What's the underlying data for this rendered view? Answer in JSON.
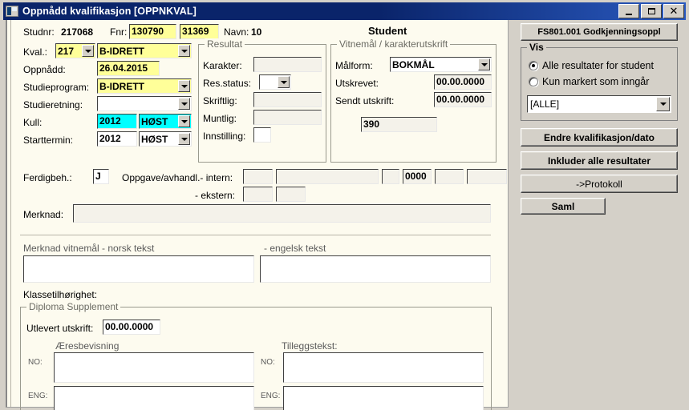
{
  "window": {
    "title": "Oppnådd kvalifikasjon [OPPNKVAL]",
    "minimize_label": "_",
    "maximize_label": "□",
    "close_label": "✕"
  },
  "header": {
    "studnr_label": "Studnr:",
    "studnr_value": "217068",
    "fnr_label": "Fnr:",
    "fnr_value1": "130790",
    "fnr_value2": "31369",
    "navn_label": "Navn:",
    "navn_value": "10",
    "student_label": "Student"
  },
  "form": {
    "kval_label": "Kval.:",
    "kval_code": "217",
    "kval_name": "B-IDRETT",
    "oppnadd_label": "Oppnådd:",
    "oppnadd_value": "26.04.2015",
    "studieprogram_label": "Studieprogram:",
    "studieprogram_value": "B-IDRETT",
    "studieretning_label": "Studieretning:",
    "studieretning_value": "",
    "kull_label": "Kull:",
    "kull_year": "2012",
    "kull_term": "HØST",
    "starttermin_label": "Starttermin:",
    "starttermin_year": "2012",
    "starttermin_term": "HØST",
    "ferdigbeh_label": "Ferdigbeh.:",
    "ferdigbeh_value": "J",
    "oppgave_intern_label": "Oppgave/avhandl.- intern:",
    "oppgave_intern_f1": "",
    "oppgave_intern_f2": "",
    "oppgave_intern_f3": "",
    "oppgave_intern_f4": "0000",
    "oppgave_intern_f5": "",
    "oppgave_intern_f6": "",
    "ekstern_label": "- ekstern:",
    "ekstern_f1": "",
    "ekstern_f2": "",
    "merknad_label": "Merknad:",
    "merknad_value": ""
  },
  "resultat": {
    "legend": "Resultat",
    "karakter_label": "Karakter:",
    "karakter_value": "",
    "resstatus_label": "Res.status:",
    "resstatus_value": "",
    "skriftlig_label": "Skriftlig:",
    "skriftlig_value": "",
    "muntlig_label": "Muntlig:",
    "muntlig_value": "",
    "innstilling_label": "Innstilling:",
    "innstilling_value": ""
  },
  "vitnemal": {
    "legend": "Vitnemål / karakterutskrift",
    "malform_label": "Målform:",
    "malform_value": "BOKMÅL",
    "utskrevet_label": "Utskrevet:",
    "utskrevet_value": "00.00.0000",
    "sendt_label": "Sendt utskrift:",
    "sendt_value": "00.00.0000",
    "extra_value": "390"
  },
  "merknad_vitnemal": {
    "norsk_label": "Merknad vitnemål - norsk tekst",
    "norsk_value": "",
    "engelsk_label": "- engelsk tekst",
    "engelsk_value": "",
    "klassetilhorighet_label": "Klassetilhørighet:",
    "klassetilhorighet_value": ""
  },
  "diploma": {
    "legend": "Diploma Supplement",
    "utlevert_label": "Utlevert utskrift:",
    "utlevert_value": "00.00.0000",
    "aeresbevisning_label": "Æresbevisning",
    "tilleggstekst_label": "Tilleggstekst:",
    "no_label": "NO:",
    "eng_label": "ENG:",
    "aeres_no_value": "",
    "aeres_eng_value": "",
    "tillegg_no_value": "",
    "tillegg_eng_value": ""
  },
  "sidebar": {
    "godkjenning_button": "FS801.001 Godkjenningsoppl",
    "vis_legend": "Vis",
    "radio_alle": "Alle resultater for student",
    "radio_kun": "Kun markert som inngår",
    "filter_value": "[ALLE]",
    "endre_button": "Endre kvalifikasjon/dato",
    "inkluder_button": "Inkluder alle resultater",
    "protokoll_button": "->Protokoll",
    "saml_button": "Saml"
  },
  "colors": {
    "titlebar": "#0a246a",
    "form_bg": "#fdfbef",
    "panel_bg": "#d4d0c8",
    "highlight_yellow": "#ffff99",
    "highlight_cyan": "#00ffff"
  }
}
